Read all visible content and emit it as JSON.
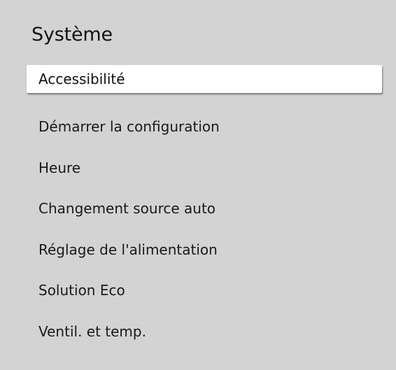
{
  "panel": {
    "title": "Système",
    "selected_index": 0,
    "items": [
      {
        "label": "Accessibilité"
      },
      {
        "label": "Démarrer la configuration"
      },
      {
        "label": "Heure"
      },
      {
        "label": "Changement source auto"
      },
      {
        "label": "Réglage de l'alimentation"
      },
      {
        "label": "Solution Eco"
      },
      {
        "label": "Ventil. et temp."
      }
    ]
  },
  "colors": {
    "panel_background": "#d3d3d3",
    "selected_background": "#ffffff",
    "text": "#1a1a1a"
  }
}
